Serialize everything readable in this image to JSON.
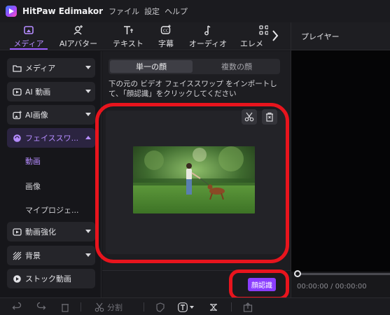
{
  "titlebar": {
    "app_name": "HitPaw Edimakor",
    "menu": [
      "ファイル",
      "設定",
      "ヘルプ"
    ]
  },
  "toolbar": {
    "tools": [
      {
        "label": "メディア",
        "icon": "media-icon",
        "active": true
      },
      {
        "label": "AIアバター",
        "icon": "ai-avatar-icon",
        "active": false
      },
      {
        "label": "テキスト",
        "icon": "text-icon",
        "active": false
      },
      {
        "label": "字幕",
        "icon": "subtitle-icon",
        "active": false
      },
      {
        "label": "オーディオ",
        "icon": "audio-icon",
        "active": false
      },
      {
        "label": "エレメ",
        "icon": "elements-icon",
        "active": false
      }
    ]
  },
  "player": {
    "title": "プレイヤー",
    "time_current": "00:00:00",
    "time_separator": "/",
    "time_total": "00:00:00"
  },
  "sidebar": {
    "items": [
      {
        "label": "メディア",
        "icon": "folder-icon"
      },
      {
        "label": "AI 動画",
        "icon": "ai-video-icon"
      },
      {
        "label": "AI画像",
        "icon": "ai-image-icon"
      },
      {
        "label": "フェイススワ...",
        "icon": "face-swap-icon",
        "open": true
      },
      {
        "label": "動画強化",
        "icon": "enhance-icon"
      },
      {
        "label": "背景",
        "icon": "background-icon"
      },
      {
        "label": "ストック動画",
        "icon": "stock-video-icon"
      }
    ],
    "subitems": [
      {
        "label": "動画",
        "active": true
      },
      {
        "label": "画像",
        "active": false
      },
      {
        "label": "マイプロジェ...",
        "active": false
      }
    ]
  },
  "main": {
    "tabs": [
      {
        "label": "単一の顔",
        "active": true
      },
      {
        "label": "複数の顔",
        "active": false
      }
    ],
    "instruction": "下の元の ビデオ フェイススワップ をインポートして、「顔認識」をクリックしてください",
    "detect_button": "顔認識"
  },
  "bottombar": {
    "split_label": "分割"
  },
  "colors": {
    "accent": "#9b5cff",
    "highlight": "#e8141d",
    "button": "#8a3dff"
  }
}
